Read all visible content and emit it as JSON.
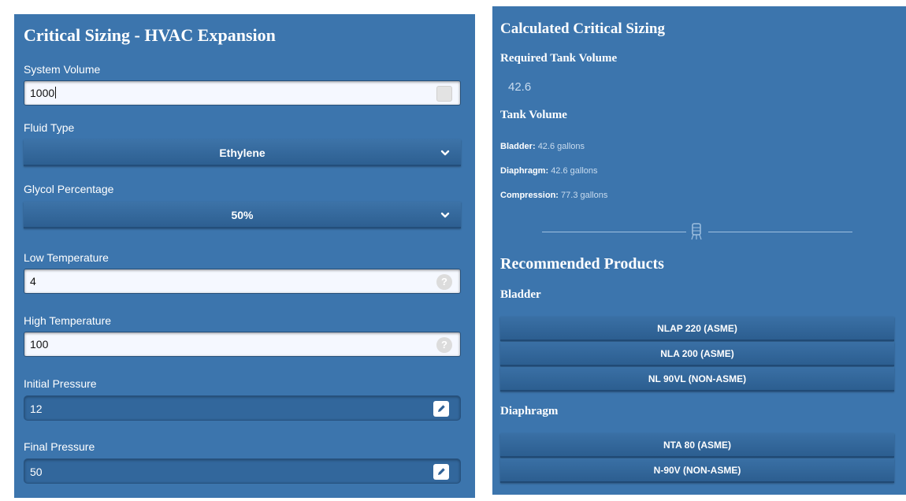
{
  "left": {
    "title": "Critical Sizing - HVAC Expansion",
    "system_volume": {
      "label": "System Volume",
      "value": "1000"
    },
    "fluid_type": {
      "label": "Fluid Type",
      "value": "Ethylene"
    },
    "glycol_percentage": {
      "label": "Glycol Percentage",
      "value": "50%"
    },
    "low_temperature": {
      "label": "Low Temperature",
      "value": "4",
      "help_glyph": "?"
    },
    "high_temperature": {
      "label": "High Temperature",
      "value": "100",
      "help_glyph": "?"
    },
    "initial_pressure": {
      "label": "Initial Pressure",
      "value": "12"
    },
    "final_pressure": {
      "label": "Final Pressure",
      "value": "50"
    }
  },
  "right": {
    "title": "Calculated Critical Sizing",
    "required_tank_volume": {
      "label": "Required Tank Volume",
      "value": "42.6"
    },
    "tank_volume": {
      "label": "Tank Volume",
      "bladder": {
        "label": "Bladder:",
        "value": "42.6 gallons"
      },
      "diaphragm": {
        "label": "Diaphragm:",
        "value": "42.6 gallons"
      },
      "compression": {
        "label": "Compression:",
        "value": "77.3 gallons"
      }
    },
    "recommended": {
      "title": "Recommended Products",
      "bladder_heading": "Bladder",
      "bladder_products": [
        "NLAP 220  (ASME)",
        "NLA 200  (ASME)",
        "NL 90VL  (NON-ASME)"
      ],
      "diaphragm_heading": "Diaphragm",
      "diaphragm_products": [
        "NTA 80  (ASME)",
        "N-90V  (NON-ASME)"
      ]
    }
  },
  "colors": {
    "panel_bg": "#3c75ad",
    "input_bg": "#f5f8ff",
    "muted_text": "#c9dcef"
  },
  "icons": {
    "edit": "pencil-icon",
    "help": "question-icon",
    "dropdown": "chevron-down-icon",
    "divider": "tank-icon"
  }
}
